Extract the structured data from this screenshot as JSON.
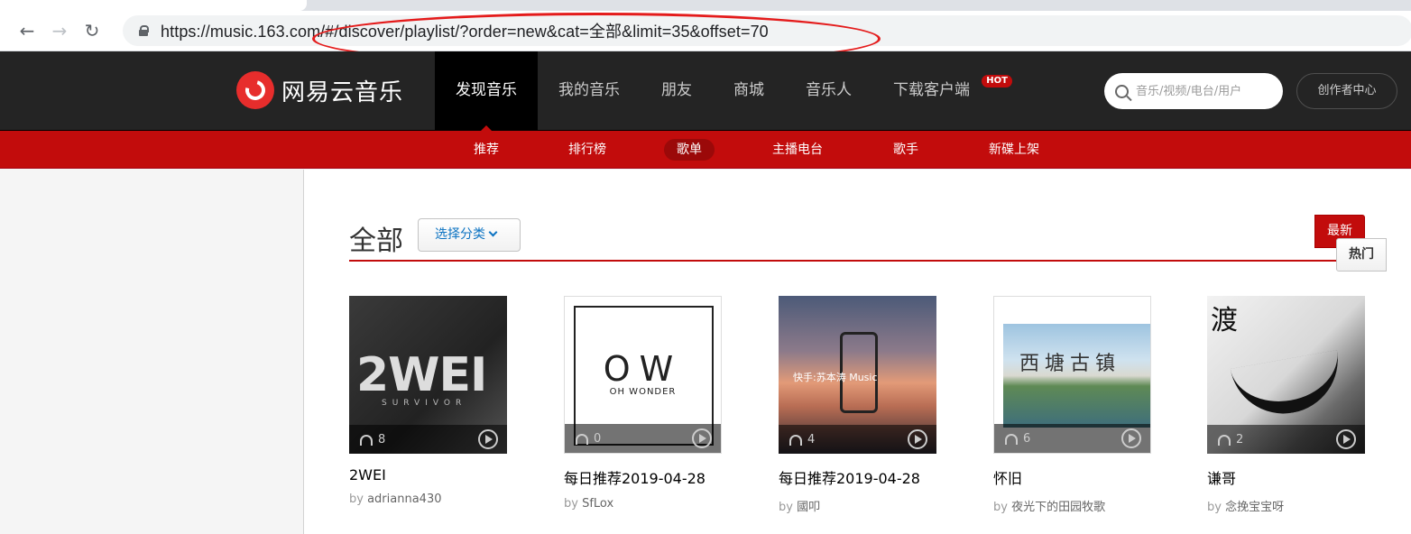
{
  "browser": {
    "url": "https://music.163.com/#/discover/playlist/?order=new&cat=全部&limit=35&offset=70"
  },
  "header": {
    "logo_text": "网易云音乐",
    "nav": [
      {
        "label": "发现音乐"
      },
      {
        "label": "我的音乐"
      },
      {
        "label": "朋友"
      },
      {
        "label": "商城"
      },
      {
        "label": "音乐人"
      },
      {
        "label": "下载客户端"
      }
    ],
    "hot_badge": "HOT",
    "search_placeholder": "音乐/视频/电台/用户",
    "creator_label": "创作者中心"
  },
  "subnav": [
    {
      "label": "推荐"
    },
    {
      "label": "排行榜"
    },
    {
      "label": "歌单"
    },
    {
      "label": "主播电台"
    },
    {
      "label": "歌手"
    },
    {
      "label": "新碟上架"
    }
  ],
  "section": {
    "category": "全部",
    "select_label": "选择分类",
    "sort_hot": "热门",
    "sort_new": "最新"
  },
  "playlists": [
    {
      "title": "2WEI",
      "by": "by",
      "creator": "adrianna430",
      "plays": "8",
      "cover_text": "2WEI",
      "cover_sub": "SURVIVOR"
    },
    {
      "title": "每日推荐2019-04-28",
      "by": "by",
      "creator": "SfLox",
      "plays": "0",
      "cover_text": "OW",
      "cover_sub": "OH WONDER"
    },
    {
      "title": "每日推荐2019-04-28",
      "by": "by",
      "creator": "國叩",
      "plays": "4",
      "cover_text": "快手:苏本涛 Music",
      "cover_sub": ""
    },
    {
      "title": "怀旧",
      "by": "by",
      "creator": "夜光下的田园牧歌",
      "plays": "6",
      "cover_text": "西塘古镇",
      "cover_sub": ""
    },
    {
      "title": "谦哥",
      "by": "by",
      "creator": "念挽宝宝呀",
      "plays": "2",
      "cover_text": "渡",
      "cover_sub": ""
    }
  ],
  "colors": {
    "brand_red": "#c20c0c",
    "header_bg": "#242424",
    "annotation_red": "#e41b1b"
  }
}
